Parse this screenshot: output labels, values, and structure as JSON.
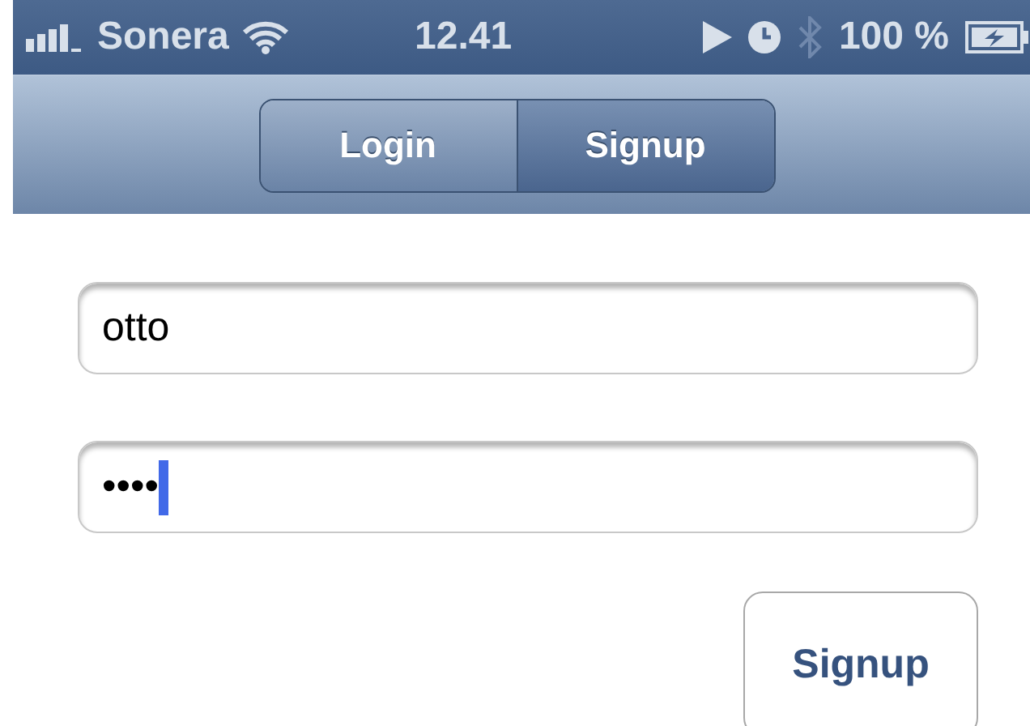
{
  "status_bar": {
    "carrier": "Sonera",
    "time": "12.41",
    "battery": "100 %",
    "bluetooth_active": false
  },
  "tabs": [
    {
      "label": "Login",
      "selected": false
    },
    {
      "label": "Signup",
      "selected": true
    }
  ],
  "fields": [
    {
      "value": "otto",
      "focused": false
    },
    {
      "value": "••••",
      "focused": true
    }
  ],
  "button": {
    "label": "Signup"
  }
}
